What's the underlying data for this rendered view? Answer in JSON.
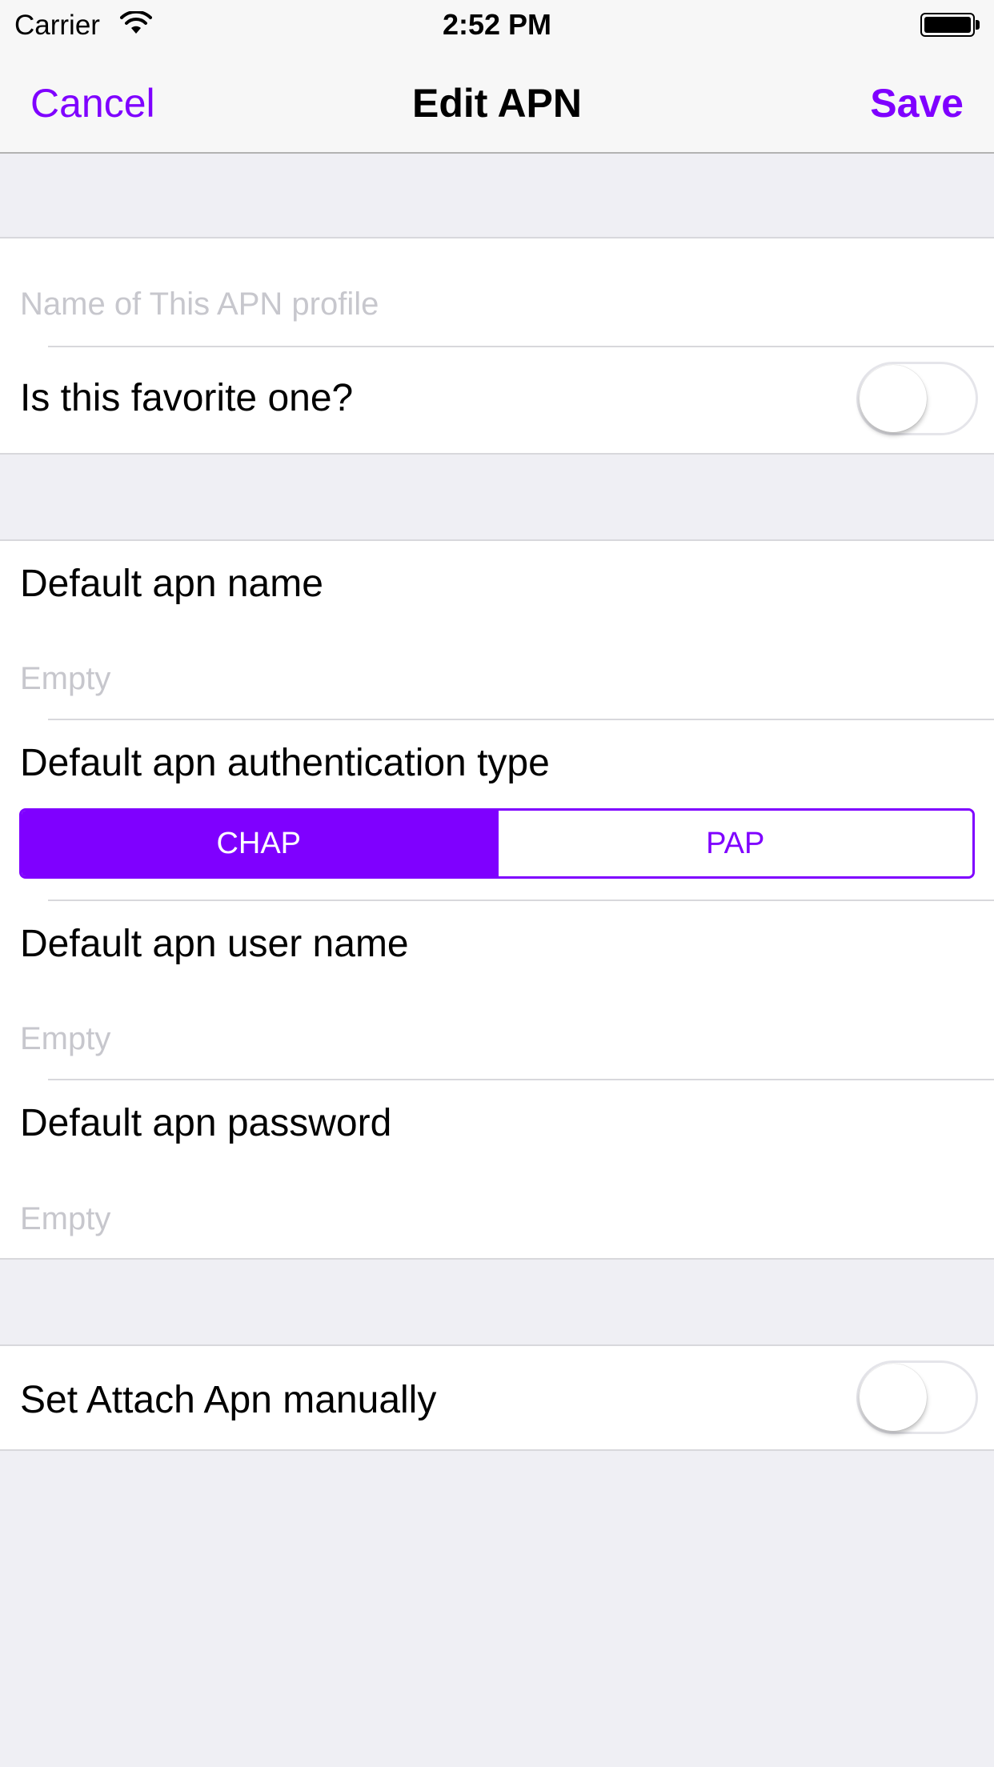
{
  "status_bar": {
    "carrier": "Carrier",
    "time": "2:52 PM",
    "wifi_icon": "wifi-icon",
    "battery_icon": "battery-icon",
    "battery_level": 1.0
  },
  "nav": {
    "cancel_label": "Cancel",
    "title": "Edit APN",
    "save_label": "Save",
    "accent_color": "#7f00ff"
  },
  "profile": {
    "name_placeholder": "Name of This APN profile",
    "name_value": "",
    "favorite_label": "Is this favorite one?",
    "favorite_on": false
  },
  "default_apn": {
    "name_label": "Default apn name",
    "name_placeholder": "Empty",
    "auth_label": "Default apn authentication type",
    "auth_options": [
      "CHAP",
      "PAP"
    ],
    "auth_selected": "CHAP",
    "user_label": "Default apn user name",
    "user_placeholder": "Empty",
    "password_label": "Default apn password",
    "password_placeholder": "Empty"
  },
  "attach": {
    "manual_label": "Set Attach Apn manually",
    "manual_on": false
  }
}
